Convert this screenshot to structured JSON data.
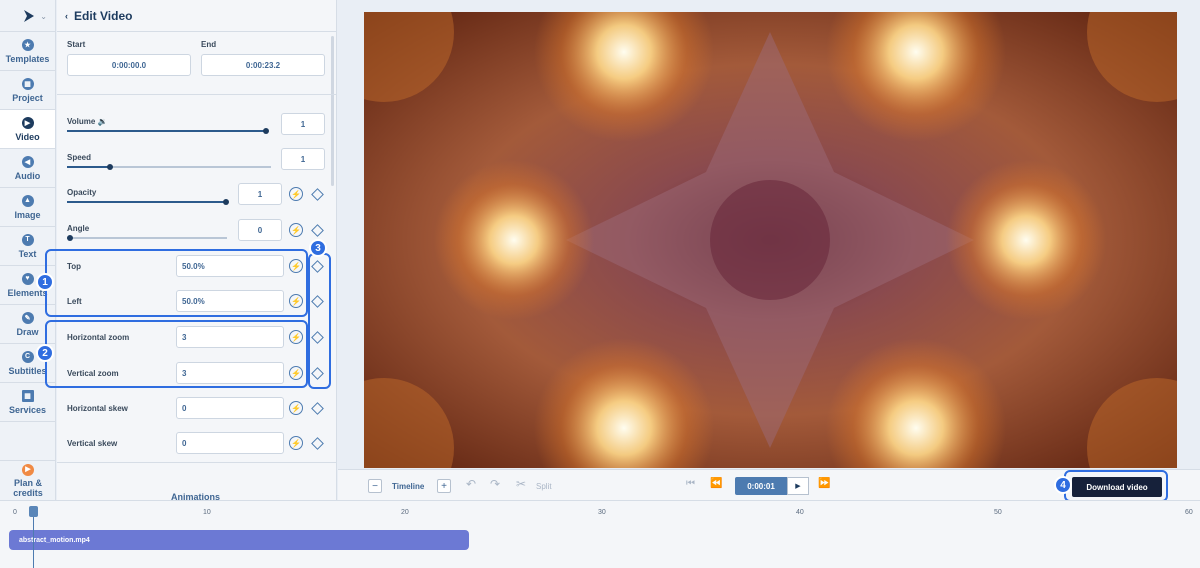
{
  "sidebar": {
    "items": [
      {
        "label": "Templates",
        "icon": "star-icon"
      },
      {
        "label": "Project",
        "icon": "grid-icon"
      },
      {
        "label": "Video",
        "icon": "play-icon"
      },
      {
        "label": "Audio",
        "icon": "audio-icon"
      },
      {
        "label": "Image",
        "icon": "image-icon"
      },
      {
        "label": "Text",
        "icon": "text-icon"
      },
      {
        "label": "Elements",
        "icon": "heart-icon"
      },
      {
        "label": "Draw",
        "icon": "pen-icon"
      },
      {
        "label": "Subtitles",
        "icon": "cc-icon"
      },
      {
        "label": "Services",
        "icon": "grid-icon"
      }
    ],
    "plan": {
      "label_line1": "Plan &",
      "label_line2": "credits"
    }
  },
  "panel": {
    "title": "Edit Video",
    "start": {
      "label": "Start",
      "value": "0:00:00.0"
    },
    "end": {
      "label": "End",
      "value": "0:00:23.2"
    },
    "volume": {
      "label": "Volume",
      "value": "1",
      "level": 1.0
    },
    "speed": {
      "label": "Speed",
      "value": "1",
      "level": 0.2
    },
    "opacity": {
      "label": "Opacity",
      "value": "1",
      "level": 1.0
    },
    "angle": {
      "label": "Angle",
      "value": "0",
      "level": 0.0
    },
    "top": {
      "label": "Top",
      "value": "50.0%"
    },
    "left": {
      "label": "Left",
      "value": "50.0%"
    },
    "hzoom": {
      "label": "Horizontal zoom",
      "value": "3"
    },
    "vzoom": {
      "label": "Vertical zoom",
      "value": "3"
    },
    "hskew": {
      "label": "Horizontal skew",
      "value": "0"
    },
    "vskew": {
      "label": "Vertical skew",
      "value": "0"
    },
    "animations": "Animations"
  },
  "badges": {
    "b1": "1",
    "b2": "2",
    "b3": "3",
    "b4": "4"
  },
  "toolbar": {
    "timeline_label": "Timeline",
    "minus": "−",
    "plus": "+",
    "split": "Split",
    "time": "0:00:01",
    "download": "Download video"
  },
  "timeline": {
    "ticks": [
      "0",
      "10",
      "20",
      "30",
      "40",
      "50",
      "60"
    ],
    "clip": "abstract_motion.mp4"
  },
  "colors": {
    "accent": "#2f6de0",
    "dark": "#16213a",
    "clip": "#6c79d4"
  }
}
